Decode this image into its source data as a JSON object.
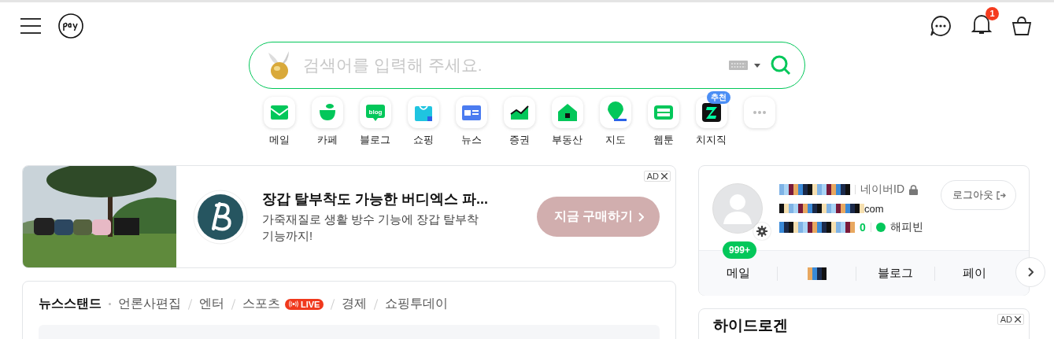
{
  "header": {
    "notification_count": "1"
  },
  "search": {
    "placeholder": "검색어를 입력해 주세요."
  },
  "shortcuts": [
    {
      "kind": "mail",
      "label": "메일"
    },
    {
      "kind": "cafe",
      "label": "카페"
    },
    {
      "kind": "blog",
      "label": "블로그",
      "icon_text": "blog"
    },
    {
      "kind": "shopping",
      "label": "쇼핑"
    },
    {
      "kind": "news",
      "label": "뉴스"
    },
    {
      "kind": "stock",
      "label": "증권"
    },
    {
      "kind": "realestate",
      "label": "부동산"
    },
    {
      "kind": "map",
      "label": "지도"
    },
    {
      "kind": "webtoon",
      "label": "웹툰"
    },
    {
      "kind": "chzzk",
      "label": "치지직",
      "badge": "추천"
    },
    {
      "kind": "more"
    }
  ],
  "ad": {
    "label": "AD",
    "title": "장갑 탈부착도 가능한 버디엑스 파...",
    "description": "가죽재질로 생활 방수 기능에 장갑 탈부착 기능까지!",
    "button": "지금 구매하기"
  },
  "profile": {
    "id_label": "네이버ID",
    "email_suffix": "com",
    "points": "0",
    "happybean": "해피빈",
    "logout": "로그아웃",
    "mail_count": "999+",
    "tabs": [
      {
        "label": "메일"
      },
      {
        "kind": "redacted"
      },
      {
        "label": "블로그"
      },
      {
        "label": "페이"
      }
    ]
  },
  "news": {
    "tabs": [
      {
        "label": "뉴스스탠드",
        "selected": true
      },
      {
        "label": "언론사편집",
        "selected": false
      },
      {
        "label": "엔터",
        "selected": false
      },
      {
        "label": "스포츠",
        "selected": false,
        "badge": "LIVE"
      },
      {
        "label": "경제",
        "selected": false
      },
      {
        "label": "쇼핑투데이",
        "selected": false
      }
    ]
  },
  "side_ad": {
    "label": "AD",
    "title": "하이드로겐"
  }
}
